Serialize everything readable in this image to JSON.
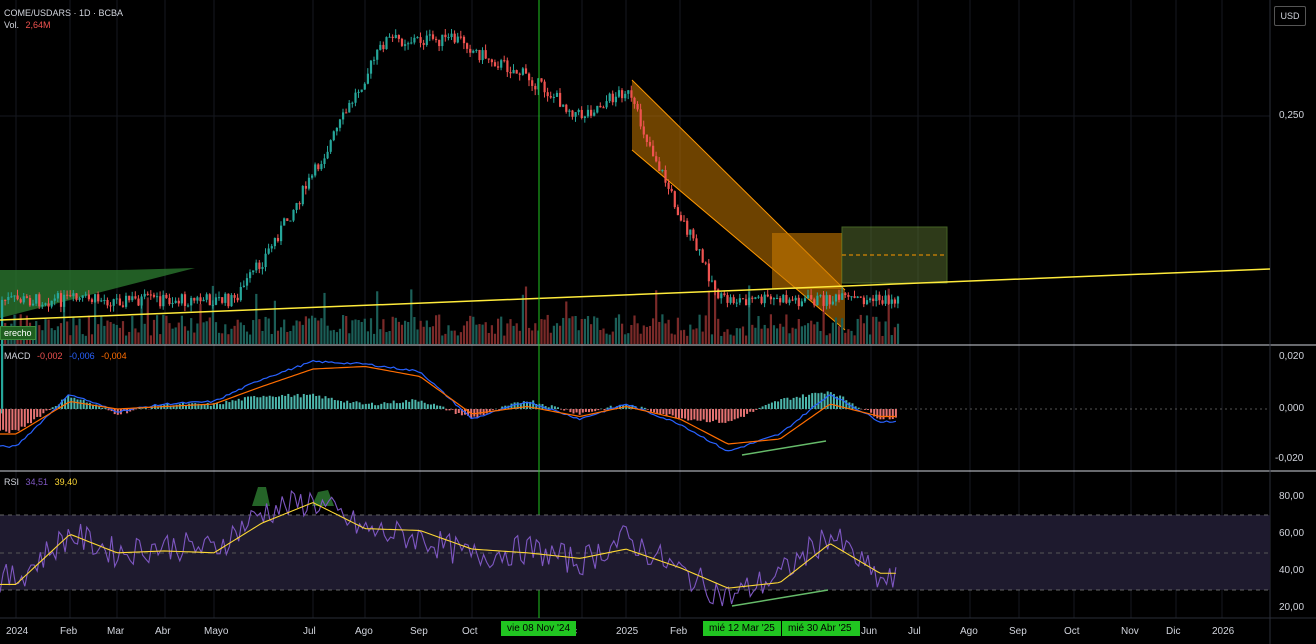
{
  "header": {
    "symbol": "COME/USDARS · 1D · BCBA",
    "vol_label": "Vol.",
    "vol_value": "2,64M",
    "currency_button": "USD"
  },
  "drawing_label": "erecho",
  "macd_legend": {
    "name": "MACD",
    "v1": "-0,002",
    "v2": "-0,006",
    "v3": "-0,004"
  },
  "rsi_legend": {
    "name": "RSI",
    "v1": "34,51",
    "v2": "39,40"
  },
  "x_axis": {
    "labels": [
      "2024",
      "Feb",
      "Mar",
      "Abr",
      "Mayo",
      "Jul",
      "Ago",
      "Sep",
      "Oct",
      "c",
      "2025",
      "Feb",
      "Jun",
      "Jul",
      "Ago",
      "Sep",
      "Oct",
      "Nov",
      "Dic",
      "2026"
    ],
    "highlight_date": "vie 08 Nov '24",
    "highlight_date_2": "mié 12 Mar '25",
    "highlight_date_3": "mié 30 Abr '25"
  },
  "price_axis": {
    "label": "0,250"
  },
  "macd_axis": {
    "top": "0,020",
    "mid": "0,000",
    "bottom": "-0,020"
  },
  "rsi_axis": {
    "l80": "80,00",
    "l60": "60,00",
    "l40": "40,00",
    "l20": "20,00"
  },
  "colors": {
    "up": "#26a69a",
    "down": "#ef5350",
    "macd": "#2962ff",
    "signal": "#ff6d00",
    "rsi": "#7e57c2",
    "rsi_ma": "#fdd835",
    "trend": "#ffeb3b",
    "channel": "#ff9800",
    "green_zone": "#4caf50"
  },
  "chart_data": [
    {
      "type": "line",
      "title": "COME/USDARS · 1D · BCBA",
      "x": [
        "2024-01",
        "2024-02",
        "2024-03",
        "2024-04",
        "2024-05",
        "2024-06",
        "2024-07",
        "2024-08",
        "2024-09",
        "2024-10",
        "2024-11",
        "2024-12",
        "2025-01",
        "2025-02",
        "2025-03",
        "2025-04",
        "2025-05",
        "2025-06"
      ],
      "series": [
        {
          "values": [
            0.16,
            0.182,
            0.176,
            0.178,
            0.186,
            0.206,
            0.232,
            0.262,
            0.292,
            0.27,
            0.262,
            0.25,
            0.258,
            0.22,
            0.19,
            0.176,
            0.182,
            0.168
          ]
        }
      ],
      "yticks": [
        "0,250"
      ]
    },
    {
      "type": "line",
      "title": "MACD",
      "series": [
        {
          "name": "MACD",
          "values": [
            -0.015,
            0.006,
            -0.001,
            0.002,
            0.003,
            0.012,
            0.019,
            0.018,
            0.015,
            -0.004,
            0.003,
            -0.004,
            0.002,
            -0.006,
            -0.017,
            -0.01,
            0.006,
            -0.005
          ]
        },
        {
          "name": "Signal",
          "values": [
            -0.01,
            0.003,
            0.0,
            0.001,
            0.002,
            0.009,
            0.016,
            0.017,
            0.013,
            -0.002,
            0.001,
            -0.003,
            0.001,
            -0.004,
            -0.014,
            -0.012,
            0.002,
            -0.003
          ]
        }
      ],
      "ylim": [
        -0.022,
        0.022
      ],
      "yticks": [
        "0,020",
        "0,000",
        "-0,020"
      ]
    },
    {
      "type": "line",
      "title": "RSI",
      "series": [
        {
          "name": "RSI",
          "values": [
            36,
            60,
            50,
            54,
            52,
            72,
            78,
            62,
            58,
            48,
            52,
            45,
            58,
            40,
            26,
            38,
            60,
            35
          ]
        },
        {
          "name": "RSI MA",
          "values": [
            33,
            60,
            50,
            51,
            50,
            66,
            77,
            63,
            62,
            52,
            50,
            47,
            52,
            42,
            31,
            34,
            55,
            39
          ]
        }
      ],
      "ylim": [
        15,
        88
      ],
      "yticks": [
        "80,00",
        "60,00",
        "40,00",
        "20,00"
      ]
    }
  ]
}
